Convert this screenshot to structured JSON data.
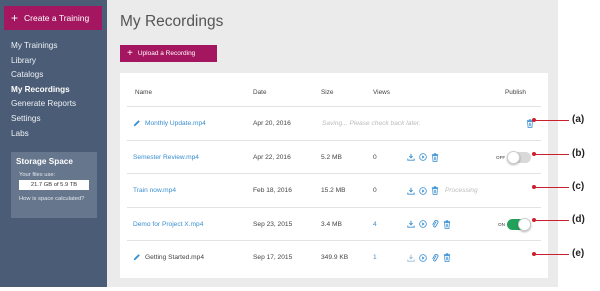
{
  "sidebar": {
    "create_label": "Create a Training",
    "nav": [
      "My Trainings",
      "Library",
      "Catalogs",
      "My Recordings",
      "Generate Reports",
      "Settings",
      "Labs"
    ],
    "active_nav": "My Recordings",
    "storage": {
      "title": "Storage Space",
      "usage_label": "Your files use:",
      "usage_value": "21.7 GB of 5.9 TB",
      "calc_link": "How is space calculated?"
    }
  },
  "main": {
    "title": "My Recordings",
    "upload_label": "Upload a Recording",
    "columns": [
      "Name",
      "Date",
      "Size",
      "Views",
      "Publish"
    ],
    "rows": [
      {
        "name": "Monthly Update.mp4",
        "date": "Apr 20, 2016",
        "status": "Saving... Please check back later.",
        "callout": "(a)"
      },
      {
        "name": "Semester Review.mp4",
        "date": "Apr 22, 2016",
        "size": "5.2 MB",
        "views": "0",
        "toggle": "OFF",
        "callout": "(b)"
      },
      {
        "name": "Train now.mp4",
        "date": "Feb 18, 2016",
        "size": "15.2 MB",
        "views": "0",
        "status": "Processing",
        "callout": "(c)"
      },
      {
        "name": "Demo for Project X.mp4",
        "date": "Sep 23, 2015",
        "size": "3.4 MB",
        "views": "4",
        "toggle": "ON",
        "callout": "(d)"
      },
      {
        "name": "Getting Started.mp4",
        "date": "Sep 17, 2015",
        "size": "349.9 KB",
        "views": "1",
        "callout": "(e)"
      }
    ]
  },
  "colors": {
    "sidebar_bg": "#4a5c76",
    "brand": "#a51660",
    "link": "#3a8fd0",
    "toggle_on": "#23a15a",
    "callout": "#cc1f2d"
  },
  "icons": [
    "plus-icon",
    "pencil-icon",
    "download-icon",
    "play-icon",
    "link-icon",
    "trash-icon"
  ]
}
